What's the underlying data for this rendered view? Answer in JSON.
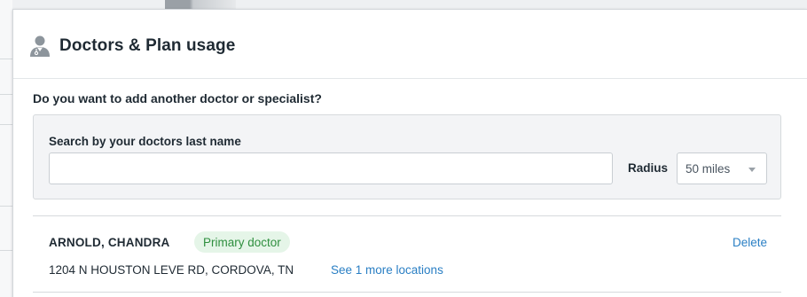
{
  "card": {
    "title": "Doctors & Plan usage",
    "icon": "doctor-user-icon"
  },
  "search": {
    "question": "Do you want to add another doctor or specialist?",
    "label": "Search by your doctors last name",
    "value": "",
    "placeholder": "",
    "radius_label": "Radius",
    "radius_value": "50 miles"
  },
  "doctors": [
    {
      "name": "ARNOLD, CHANDRA",
      "badge": "Primary doctor",
      "address": "1204 N HOUSTON LEVE RD, CORDOVA, TN",
      "more_locations": "See 1 more locations",
      "delete_label": "Delete"
    }
  ],
  "colors": {
    "accent_link": "#2a7fc4",
    "badge_text": "#2f8f3f",
    "badge_bg": "#e5f5e8",
    "panel_bg": "#f3f4f6"
  }
}
